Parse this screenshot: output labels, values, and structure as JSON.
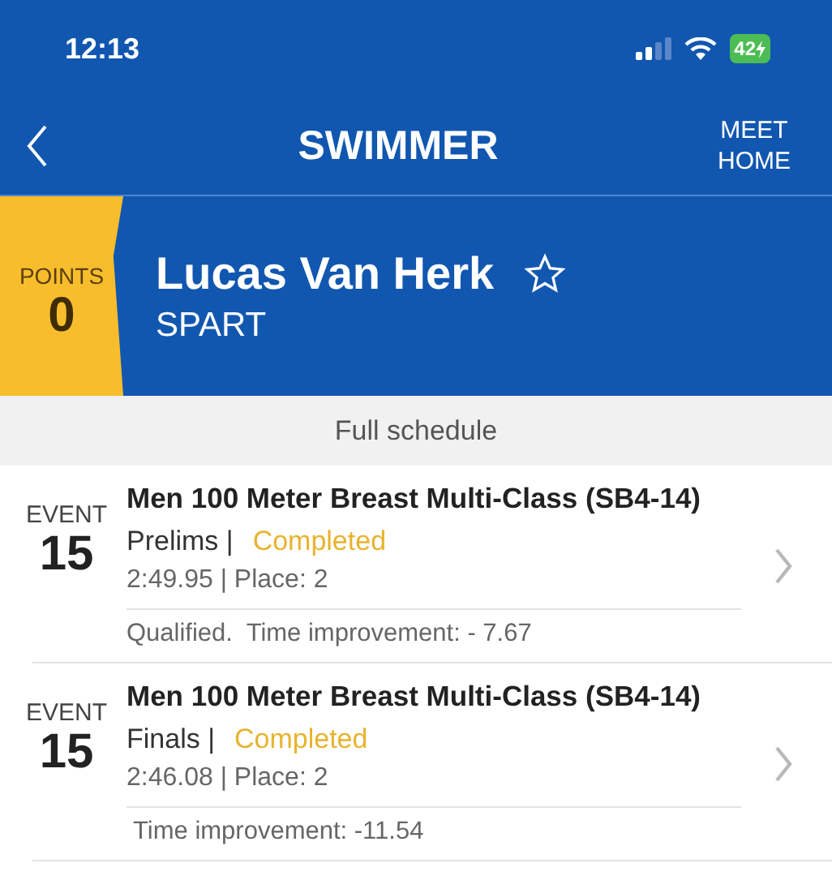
{
  "status_bar": {
    "time": "12:13",
    "battery": "42"
  },
  "nav": {
    "title": "SWIMMER",
    "right_button": "MEET\nHOME"
  },
  "swimmer": {
    "points_label": "POINTS",
    "points": "0",
    "name": "Lucas Van Herk",
    "favorite": false,
    "team": "SPART"
  },
  "schedule_button": "Full schedule",
  "events": [
    {
      "label": "EVENT",
      "number": "15",
      "title": "Men 100 Meter Breast Multi-Class (SB4-14)",
      "round": "Prelims |",
      "status": "Completed",
      "result": "2:49.95 | Place: 2",
      "note": "Qualified.  Time improvement: - 7.67"
    },
    {
      "label": "EVENT",
      "number": "15",
      "title": "Men 100 Meter Breast Multi-Class (SB4-14)",
      "round": "Finals |",
      "status": "Completed",
      "result": "2:46.08 | Place: 2",
      "note": " Time improvement: -11.54"
    }
  ]
}
